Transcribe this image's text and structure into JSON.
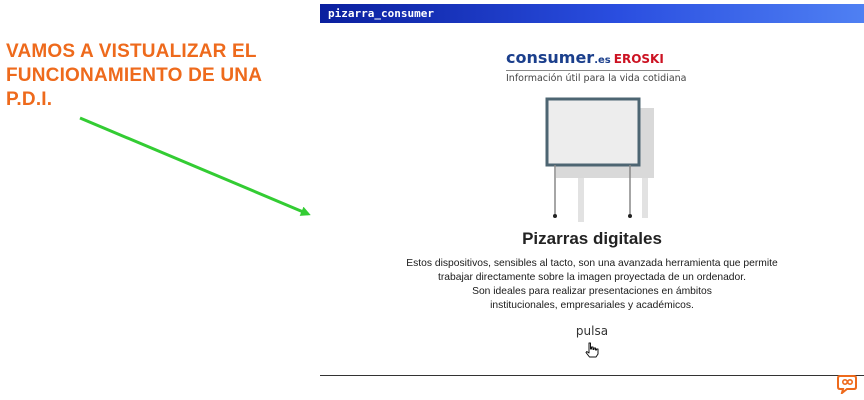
{
  "annotation": {
    "text": "VAMOS A VISTUALIZAR EL\nFUNCIONAMIENTO DE UNA\nP.D.I.",
    "color": "#ee6a1c"
  },
  "arrow": {
    "color": "#33cc33",
    "icon": "arrow-icon"
  },
  "window": {
    "title": "pizarra_consumer"
  },
  "brand": {
    "name": "consumer",
    "domain": ".es",
    "partner": "EROSKI",
    "tagline": "Información útil para la vida cotidiana",
    "primary_color": "#1b3f8c",
    "partner_color": "#cc1222"
  },
  "content": {
    "headline": "Pizarras digitales",
    "paragraph_lines": [
      "Estos dispositivos, sensibles al tacto, son una avanzada herramienta que permite",
      "trabajar directamente sobre la imagen proyectada de un ordenador.",
      "Son ideales para realizar presentaciones en ámbitos",
      "institucionales, empresariales y académicos."
    ],
    "action_label": "pulsa",
    "action_icon": "hand-pointer-icon",
    "illustration_icon": "whiteboard-icon"
  },
  "footer": {
    "logo_icon": "presentation-logo-icon",
    "logo_color": "#ee6a1c"
  }
}
